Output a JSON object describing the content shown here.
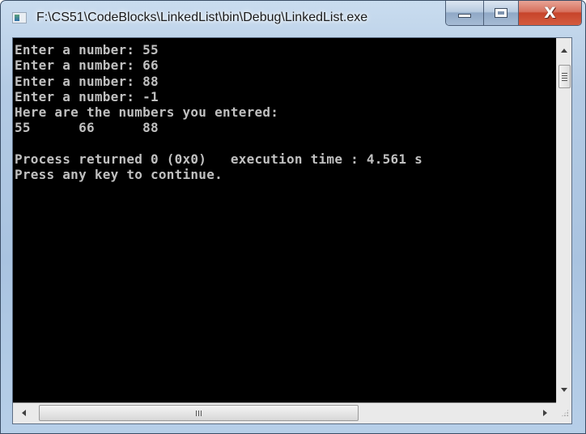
{
  "window": {
    "title": "F:\\CS51\\CodeBlocks\\LinkedList\\bin\\Debug\\LinkedList.exe",
    "app_icon": "console-app-icon",
    "caption_buttons": {
      "minimize": "minimize-icon",
      "maximize": "maximize-icon",
      "close": "close-icon",
      "close_glyph": "X"
    }
  },
  "console": {
    "text_color": "#c0c0c0",
    "background": "#000000",
    "lines": [
      "Enter a number: 55",
      "Enter a number: 66",
      "Enter a number: 88",
      "Enter a number: -1",
      "Here are the numbers you entered:",
      "55      66      88",
      "",
      "Process returned 0 (0x0)   execution time : 4.561 s",
      "Press any key to continue."
    ]
  },
  "scrollbars": {
    "vertical": {
      "up_icon": "arrow-up-icon",
      "down_icon": "arrow-down-icon",
      "thumb_grip": "|||"
    },
    "horizontal": {
      "left_icon": "arrow-left-icon",
      "right_icon": "arrow-right-icon",
      "thumb_grip": "III"
    }
  }
}
